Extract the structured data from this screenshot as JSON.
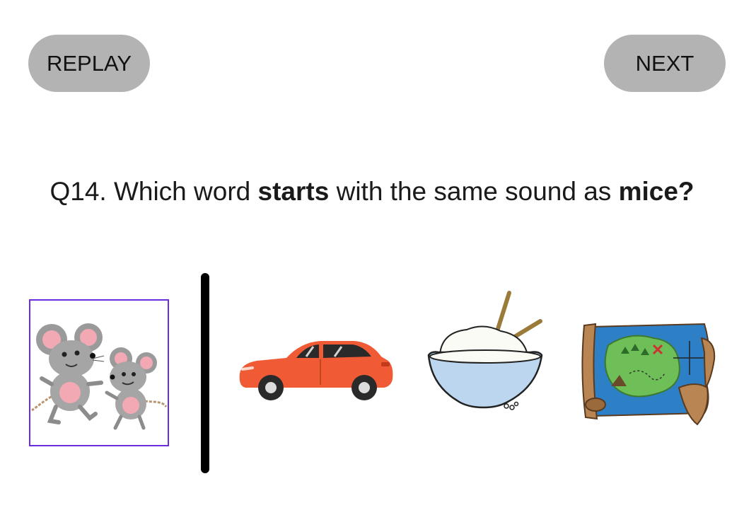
{
  "buttons": {
    "replay_label": "REPLAY",
    "next_label": "NEXT"
  },
  "question": {
    "prefix": "Q14. Which word ",
    "emphasis_verb": "starts",
    "middle": " with the same sound as ",
    "target_word": "mice?"
  },
  "target_picture": {
    "icon": "mice-icon",
    "border_color": "#6a2ee0"
  },
  "options": [
    {
      "icon": "car-icon"
    },
    {
      "icon": "rice-bowl-icon"
    },
    {
      "icon": "treasure-map-icon"
    }
  ],
  "colors": {
    "button_bg": "#b3b3b3",
    "divider": "#000000",
    "car_body": "#f05a35"
  }
}
